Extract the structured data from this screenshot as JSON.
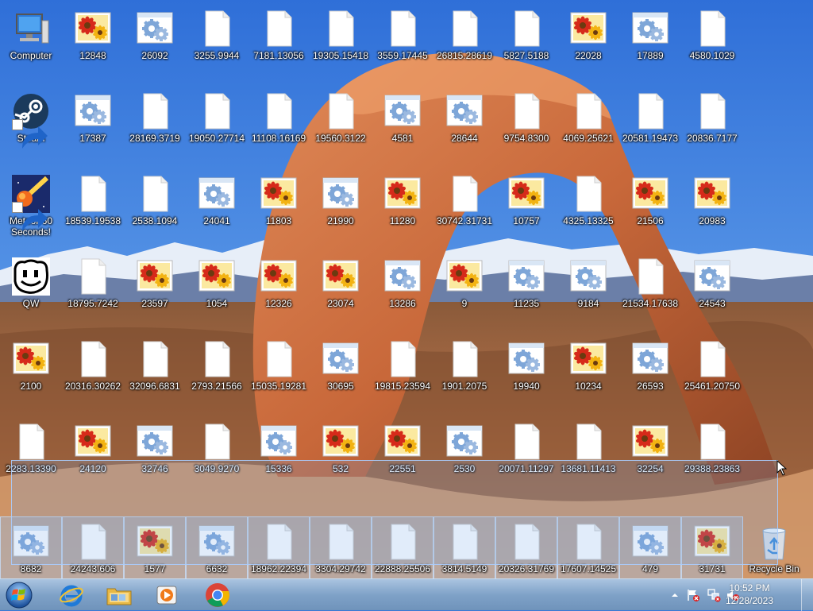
{
  "desktop": {
    "columns": [
      [
        {
          "label": "Computer",
          "type": "computer"
        },
        {
          "label": "Steam",
          "type": "steam"
        },
        {
          "label": "Meteor 60 Seconds!",
          "type": "meteor"
        },
        {
          "label": "QW",
          "type": "qw"
        },
        {
          "label": "2100",
          "type": "image"
        },
        {
          "label": "2283.13390",
          "type": "file"
        },
        {
          "label": "8682",
          "type": "config",
          "selected": true
        }
      ],
      [
        {
          "label": "12848",
          "type": "image"
        },
        {
          "label": "17387",
          "type": "config"
        },
        {
          "label": "18539.19538",
          "type": "file"
        },
        {
          "label": "18795.7242",
          "type": "file"
        },
        {
          "label": "20316.30262",
          "type": "file"
        },
        {
          "label": "24120",
          "type": "image"
        },
        {
          "label": "24243.606",
          "type": "file",
          "selected": true
        }
      ],
      [
        {
          "label": "26092",
          "type": "config"
        },
        {
          "label": "28169.3719",
          "type": "file"
        },
        {
          "label": "2538.1094",
          "type": "file"
        },
        {
          "label": "23597",
          "type": "image"
        },
        {
          "label": "32096.6831",
          "type": "file"
        },
        {
          "label": "32746",
          "type": "config"
        },
        {
          "label": "1577",
          "type": "image",
          "selected": true
        }
      ],
      [
        {
          "label": "3255.9944",
          "type": "file"
        },
        {
          "label": "19050.27714",
          "type": "file"
        },
        {
          "label": "24041",
          "type": "config"
        },
        {
          "label": "1054",
          "type": "image"
        },
        {
          "label": "2793.21566",
          "type": "file"
        },
        {
          "label": "3049.9270",
          "type": "file"
        },
        {
          "label": "6632",
          "type": "config",
          "selected": true
        }
      ],
      [
        {
          "label": "7181.13056",
          "type": "file"
        },
        {
          "label": "11108.16169",
          "type": "file"
        },
        {
          "label": "11803",
          "type": "image"
        },
        {
          "label": "12326",
          "type": "image"
        },
        {
          "label": "15035.19281",
          "type": "file"
        },
        {
          "label": "15336",
          "type": "config"
        },
        {
          "label": "18962.22394",
          "type": "file",
          "selected": true
        }
      ],
      [
        {
          "label": "19305.15418",
          "type": "file"
        },
        {
          "label": "19560.3122",
          "type": "file"
        },
        {
          "label": "21990",
          "type": "config"
        },
        {
          "label": "23074",
          "type": "image"
        },
        {
          "label": "30695",
          "type": "config"
        },
        {
          "label": "532",
          "type": "image"
        },
        {
          "label": "3304.29742",
          "type": "file",
          "selected": true
        }
      ],
      [
        {
          "label": "3559.17445",
          "type": "file"
        },
        {
          "label": "4581",
          "type": "config"
        },
        {
          "label": "11280",
          "type": "image"
        },
        {
          "label": "13286",
          "type": "config"
        },
        {
          "label": "19815.23594",
          "type": "file"
        },
        {
          "label": "22551",
          "type": "image"
        },
        {
          "label": "22888.25506",
          "type": "file",
          "selected": true
        }
      ],
      [
        {
          "label": "26815.28619",
          "type": "file"
        },
        {
          "label": "28644",
          "type": "config"
        },
        {
          "label": "30742.31731",
          "type": "file"
        },
        {
          "label": "9",
          "type": "image"
        },
        {
          "label": "1901.2075",
          "type": "file"
        },
        {
          "label": "2530",
          "type": "config"
        },
        {
          "label": "3814.5149",
          "type": "file",
          "selected": true
        }
      ],
      [
        {
          "label": "5827.5188",
          "type": "file"
        },
        {
          "label": "9754.8300",
          "type": "file"
        },
        {
          "label": "10757",
          "type": "image"
        },
        {
          "label": "11235",
          "type": "config"
        },
        {
          "label": "19940",
          "type": "config"
        },
        {
          "label": "20071.11297",
          "type": "file"
        },
        {
          "label": "20326.31769",
          "type": "file",
          "selected": true
        }
      ],
      [
        {
          "label": "22028",
          "type": "image"
        },
        {
          "label": "4069.25621",
          "type": "file"
        },
        {
          "label": "4325.13325",
          "type": "file"
        },
        {
          "label": "9184",
          "type": "config"
        },
        {
          "label": "10234",
          "type": "image"
        },
        {
          "label": "13681.11413",
          "type": "file"
        },
        {
          "label": "17607.14525",
          "type": "file",
          "selected": true
        }
      ],
      [
        {
          "label": "17889",
          "type": "config"
        },
        {
          "label": "20581.19473",
          "type": "file"
        },
        {
          "label": "21506",
          "type": "image"
        },
        {
          "label": "21534.17638",
          "type": "file"
        },
        {
          "label": "26593",
          "type": "config"
        },
        {
          "label": "32254",
          "type": "image"
        },
        {
          "label": "479",
          "type": "config",
          "selected": true
        }
      ],
      [
        {
          "label": "4580.1029",
          "type": "file"
        },
        {
          "label": "20836.7177",
          "type": "file"
        },
        {
          "label": "20983",
          "type": "image"
        },
        {
          "label": "24543",
          "type": "config"
        },
        {
          "label": "25461.20750",
          "type": "file"
        },
        {
          "label": "29388.23863",
          "type": "file"
        },
        {
          "label": "31731",
          "type": "image",
          "selected": true
        }
      ],
      [
        {
          "label": "Recycle Bin",
          "type": "recycle"
        }
      ]
    ]
  },
  "taskbar": {
    "start_icon": "windows-orb-icon",
    "apps": [
      {
        "name": "Internet Explorer",
        "icon": "internet-explorer-icon"
      },
      {
        "name": "File Explorer",
        "icon": "folder-icon"
      },
      {
        "name": "Media Player",
        "icon": "media-player-icon"
      },
      {
        "name": "Chrome",
        "icon": "chrome-icon"
      }
    ]
  },
  "clock": {
    "time": "10:52 PM",
    "date": "12/28/2023"
  },
  "colors": {
    "taskbar": "#7fa2c8",
    "selection": "#96c3f5",
    "label_text": "#ffffff"
  }
}
